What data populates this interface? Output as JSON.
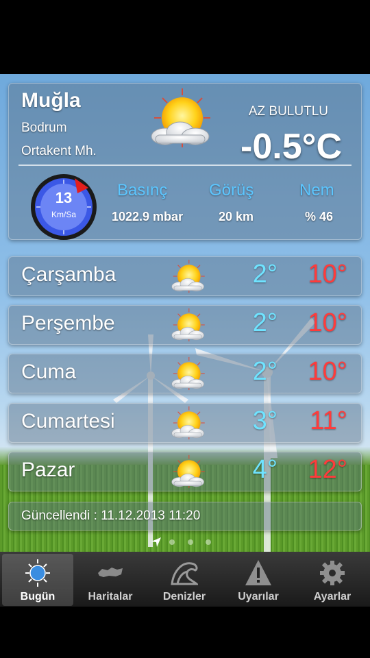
{
  "location": {
    "city": "Muğla",
    "district": "Bodrum",
    "neighborhood": "Ortakent Mh."
  },
  "current": {
    "condition": "AZ BULUTLU",
    "temperature": "-0.5°C",
    "icon": "partly-cloudy-icon"
  },
  "wind": {
    "speed": "13",
    "unit": "Km/Sa"
  },
  "stats": [
    {
      "label": "Basınç",
      "value": "1022.9 mbar"
    },
    {
      "label": "Görüş",
      "value": "20 km"
    },
    {
      "label": "Nem",
      "value": "% 46"
    }
  ],
  "forecast": [
    {
      "day": "Çarşamba",
      "low": "2°",
      "high": "10°",
      "icon": "partly-cloudy-icon"
    },
    {
      "day": "Perşembe",
      "low": "2°",
      "high": "10°",
      "icon": "partly-cloudy-icon"
    },
    {
      "day": "Cuma",
      "low": "2°",
      "high": "10°",
      "icon": "partly-cloudy-icon"
    },
    {
      "day": "Cumartesi",
      "low": "3°",
      "high": "11°",
      "icon": "partly-cloudy-icon"
    },
    {
      "day": "Pazar",
      "low": "4°",
      "high": "12°",
      "icon": "partly-cloudy-icon"
    }
  ],
  "updated": "Güncellendi : 11.12.2013 11:20",
  "tabs": [
    {
      "label": "Bugün",
      "icon": "sun-icon",
      "active": true
    },
    {
      "label": "Haritalar",
      "icon": "map-icon",
      "active": false
    },
    {
      "label": "Denizler",
      "icon": "wave-icon",
      "active": false
    },
    {
      "label": "Uyarılar",
      "icon": "warning-icon",
      "active": false
    },
    {
      "label": "Ayarlar",
      "icon": "gear-icon",
      "active": false
    }
  ],
  "colors": {
    "low_temp": "#6fe3ff",
    "high_temp": "#ff3b3b",
    "stat_label": "#5cc6ff"
  }
}
